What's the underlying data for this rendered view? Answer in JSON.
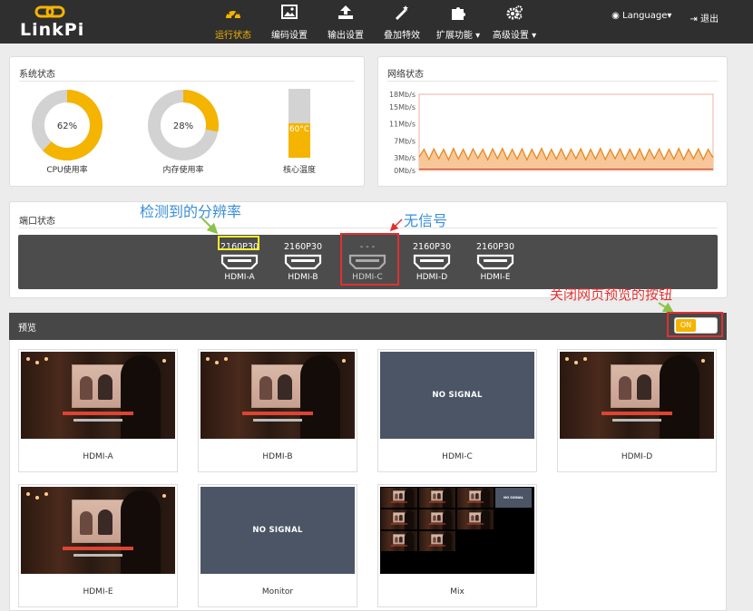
{
  "header": {
    "logo_text": "LinkPi",
    "nav": [
      {
        "label": "运行状态",
        "icon": "dashboard-icon",
        "active": true
      },
      {
        "label": "编码设置",
        "icon": "image-icon",
        "active": false
      },
      {
        "label": "输出设置",
        "icon": "upload-icon",
        "active": false
      },
      {
        "label": "叠加特效",
        "icon": "magic-wand-icon",
        "active": false
      },
      {
        "label": "扩展功能",
        "icon": "puzzle-icon",
        "active": false
      },
      {
        "label": "高级设置",
        "icon": "gears-icon",
        "active": false
      }
    ],
    "language_label": "Language",
    "logout_label": "退出",
    "accent_color": "#f4b400"
  },
  "system_status": {
    "title": "系统状态",
    "cpu": {
      "value_label": "62%",
      "value": 62,
      "caption": "CPU使用率"
    },
    "memory": {
      "value_label": "28%",
      "value": 28,
      "caption": "内存使用率"
    },
    "temperature": {
      "value_label": "60°C",
      "level": 0.5,
      "caption": "核心温度"
    }
  },
  "network_status": {
    "title": "网络状态",
    "y_ticks": [
      "18Mb/s",
      "15Mb/s",
      "11Mb/s",
      "7Mb/s",
      "3Mb/s",
      "0Mb/s"
    ]
  },
  "chart_data": {
    "type": "area",
    "y_unit": "Mb/s",
    "ylim": [
      0,
      18
    ],
    "series": [
      {
        "values": [
          3.2,
          5.0,
          2.6,
          5.1,
          2.8,
          5.0,
          2.5,
          5.2,
          2.7,
          5.0,
          2.6,
          5.1,
          2.9,
          5.0,
          2.5,
          5.1,
          2.8,
          5.2,
          2.6,
          5.0,
          2.7,
          5.1,
          2.5,
          5.0,
          2.8,
          5.2,
          2.6,
          5.0,
          2.7,
          5.1,
          2.6,
          5.0,
          2.8,
          5.1,
          2.5,
          5.0,
          2.7,
          5.2,
          2.6,
          5.0,
          2.8,
          5.1,
          2.6,
          5.0,
          2.7,
          5.1,
          2.5,
          5.0,
          2.8,
          5.1,
          2.6,
          5.0,
          2.7,
          5.2,
          2.6,
          5.0,
          2.8,
          5.1,
          2.6,
          5.0,
          3.0
        ]
      },
      {
        "values": [
          0.3,
          0.3,
          0.3,
          0.3,
          0.3,
          0.3,
          0.3,
          0.3,
          0.3,
          0.3,
          0.3,
          0.3,
          0.3,
          0.3,
          0.3,
          0.3,
          0.3,
          0.3,
          0.3,
          0.3,
          0.3,
          0.3,
          0.3,
          0.3,
          0.3,
          0.3,
          0.3,
          0.3,
          0.3,
          0.3,
          0.3,
          0.3,
          0.3,
          0.3,
          0.3,
          0.3,
          0.3,
          0.3,
          0.3,
          0.3,
          0.3,
          0.3,
          0.3,
          0.3,
          0.3,
          0.3,
          0.3,
          0.3,
          0.3,
          0.3,
          0.3,
          0.3,
          0.3,
          0.3,
          0.3,
          0.3,
          0.3,
          0.3,
          0.3,
          0.3,
          0.3
        ]
      }
    ]
  },
  "port_status": {
    "title": "端口状态",
    "ports": [
      {
        "resolution": "2160P30",
        "name": "HDMI-A",
        "signal": true
      },
      {
        "resolution": "2160P30",
        "name": "HDMI-B",
        "signal": true
      },
      {
        "resolution": "- - -",
        "name": "HDMI-C",
        "signal": false
      },
      {
        "resolution": "2160P30",
        "name": "HDMI-D",
        "signal": true
      },
      {
        "resolution": "2160P30",
        "name": "HDMI-E",
        "signal": true
      }
    ]
  },
  "annotations": {
    "resolution_detected": "检测到的分辨率",
    "no_signal": "无信号",
    "close_preview_button": "关闭网页预览的按钮"
  },
  "preview": {
    "title": "预览",
    "toggle_label": "ON",
    "no_signal_text": "NO SIGNAL",
    "tiles": [
      {
        "caption": "HDMI-A",
        "kind": "video"
      },
      {
        "caption": "HDMI-B",
        "kind": "video"
      },
      {
        "caption": "HDMI-C",
        "kind": "nosignal"
      },
      {
        "caption": "HDMI-D",
        "kind": "video"
      },
      {
        "caption": "HDMI-E",
        "kind": "video"
      },
      {
        "caption": "Monitor",
        "kind": "nosignal"
      },
      {
        "caption": "Mix",
        "kind": "mix"
      }
    ]
  }
}
